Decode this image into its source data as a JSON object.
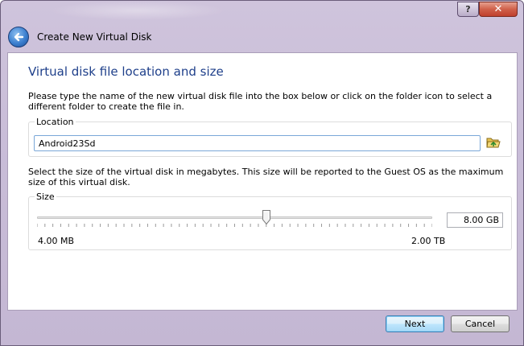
{
  "titlebar": {
    "help_label": "?",
    "close_label": "✕"
  },
  "header": {
    "title": "Create New Virtual Disk"
  },
  "page": {
    "title": "Virtual disk file location and size",
    "location_description": "Please type the name of the new virtual disk file into the box below or click on the folder icon to select a different folder to create the file in.",
    "size_description": "Select the size of the virtual disk in megabytes. This size will be reported to the Guest OS as the maximum size of this virtual disk."
  },
  "location": {
    "group_label": "Location",
    "value": "Android23Sd",
    "folder_icon": "folder-open-icon"
  },
  "size": {
    "group_label": "Size",
    "value": "8.00 GB",
    "min_label": "4.00 MB",
    "max_label": "2.00 TB",
    "slider_fraction": 0.58
  },
  "buttons": {
    "next_label": "Next",
    "cancel_label": "Cancel"
  },
  "colors": {
    "title_accent": "#1e3f8a",
    "window_frame": "#c9bdd8",
    "close_button": "#c0402e",
    "default_button_border": "#3c7fb1"
  }
}
